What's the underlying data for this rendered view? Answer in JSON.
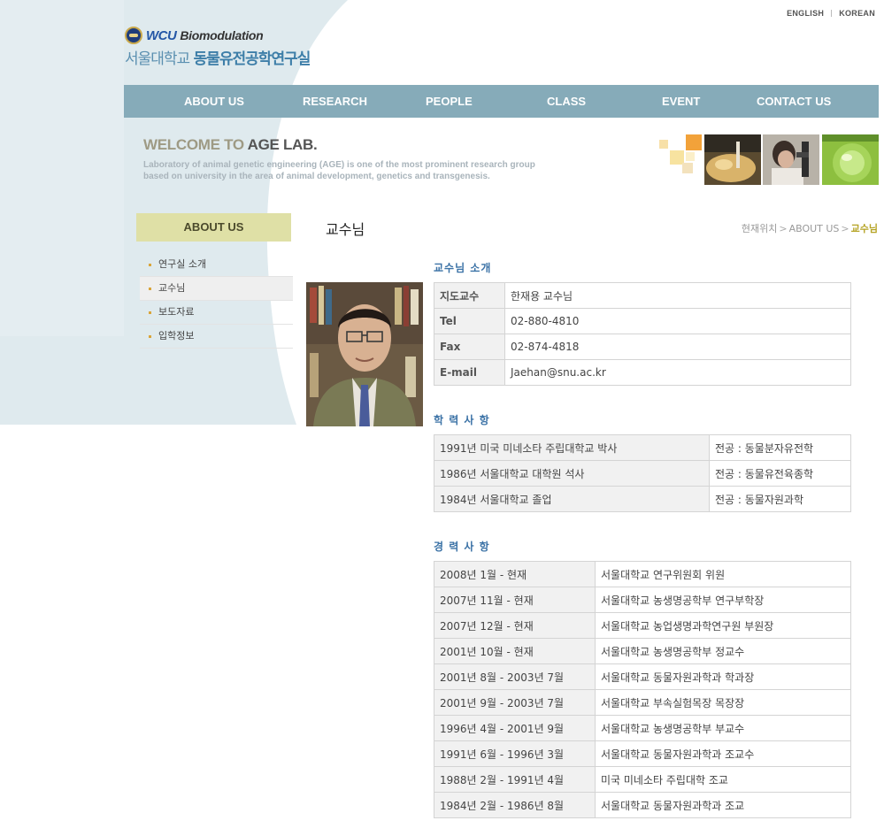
{
  "header": {
    "lang_links": [
      "ENGLISH",
      "KOREAN"
    ],
    "logo": {
      "wcu": "WCU",
      "biomodulation": "Biomodulation",
      "univ": "서울대학교",
      "lab": "동물유전공학연구실"
    }
  },
  "nav": {
    "items": [
      "ABOUT US",
      "RESEARCH",
      "PEOPLE",
      "CLASS",
      "EVENT",
      "CONTACT US"
    ]
  },
  "welcome": {
    "title_prefix": "WELCOME TO",
    "title_lab": "AGE LAB.",
    "desc": "Laboratory of animal genetic engineering (AGE) is one of the most prominent research group based on university in the area of animal development, genetics and transgenesis."
  },
  "sidebar": {
    "title": "ABOUT US",
    "items": [
      "연구실 소개",
      "교수님",
      "보도자료",
      "입학정보"
    ],
    "active_index": 1
  },
  "page": {
    "title": "교수님",
    "breadcrumb": [
      "현재위치",
      "ABOUT US",
      "교수님"
    ]
  },
  "profile": {
    "title": "교수님 소개",
    "rows": [
      {
        "label": "지도교수",
        "value": "한재용 교수님"
      },
      {
        "label": "Tel",
        "value": "02-880-4810"
      },
      {
        "label": "Fax",
        "value": "02-874-4818"
      },
      {
        "label": "E-mail",
        "value": "Jaehan@snu.ac.kr"
      }
    ]
  },
  "education": {
    "title": "학 력 사 항",
    "rows": [
      {
        "degree": "1991년 미국 미네소타 주립대학교 박사",
        "major": "전공 : 동물분자유전학"
      },
      {
        "degree": "1986년 서울대학교 대학원 석사",
        "major": "전공 : 동물유전육종학"
      },
      {
        "degree": "1984년 서울대학교 졸업",
        "major": "전공 : 동물자원과학"
      }
    ]
  },
  "career": {
    "title": "경 력 사 항",
    "rows": [
      {
        "period": "2008년 1월 - 현재",
        "role": "서울대학교 연구위원회 위원"
      },
      {
        "period": "2007년 11월 - 현재",
        "role": "서울대학교 농생명공학부 연구부학장"
      },
      {
        "period": "2007년 12월 - 현재",
        "role": "서울대학교 농업생명과학연구원 부원장"
      },
      {
        "period": "2001년 10월 - 현재",
        "role": "서울대학교 농생명공학부 정교수"
      },
      {
        "period": "2001년 8월 - 2003년 7월",
        "role": "서울대학교 동물자원과학과 학과장"
      },
      {
        "period": "2001년 9월 - 2003년 7월",
        "role": "서울대학교 부속실험목장 목장장"
      },
      {
        "period": "1996년 4월 - 2001년 9월",
        "role": "서울대학교 농생명공학부 부교수"
      },
      {
        "period": "1991년 6월 - 1996년 3월",
        "role": "서울대학교 동물자원과학과 조교수"
      },
      {
        "period": "1988년 2월 - 1991년 4월",
        "role": "미국 미네소타 주립대학 조교"
      },
      {
        "period": "1984년 2월 - 1986년 8월",
        "role": "서울대학교 동물자원과학과 조교"
      }
    ]
  },
  "colors": {
    "nav": "#86abb9",
    "accent_blue": "#3b72a6",
    "sidebar_title": "#dfe0a6",
    "crumb_current": "#b5a323"
  }
}
